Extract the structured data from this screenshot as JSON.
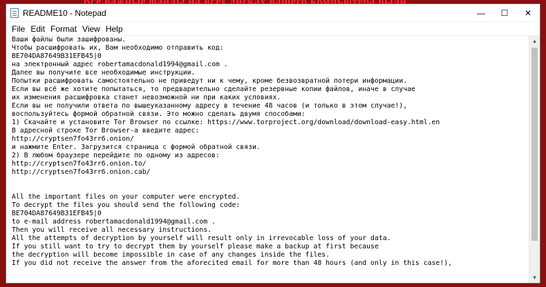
{
  "background": {
    "banner_text": "Все важные файлы на всех дисках вашего компьютера были"
  },
  "window": {
    "title": "README10 - Notepad",
    "controls": {
      "minimize": "—",
      "maximize": "☐",
      "close": "✕"
    }
  },
  "menu": [
    "File",
    "Edit",
    "Format",
    "View",
    "Help"
  ],
  "content": {
    "lines": [
      "Ваши файлы были зашифрованы.",
      "Чтобы расшифровать их, Вам необходимо отправить код:",
      "BE704DA87649B31EFB45|0",
      "на электронный адрес robertamacdonald1994@gmail.com .",
      "Далее вы получите все необходимые инструкции.",
      "Попытки расшифровать самостоятельно не приведут ни к чему, кроме безвозвратной потери информации.",
      "Если вы всё же хотите попытаться, то предварительно сделайте резервные копии файлов, иначе в случае",
      "их изменения расшифровка станет невозможной ни при каких условиях.",
      "Если вы не получили ответа по вышеуказанному адресу в течение 48 часов (и только в этом случае!),",
      "воспользуйтесь формой обратной связи. Это можно сделать двумя способами:",
      "1) Скачайте и установите Tor Browser по ссылке: https://www.torproject.org/download/download-easy.html.en",
      "В адресной строке Tor Browser-а введите адрес:",
      "http://cryptsen7fo43rr6.onion/",
      "и нажмите Enter. Загрузится страница с формой обратной связи.",
      "2) В любом браузере перейдите по одному из адресов:",
      "http://cryptsen7fo43rr6.onion.to/",
      "http://cryptsen7fo43rr6.onion.cab/",
      "",
      "",
      "All the important files on your computer were encrypted.",
      "To decrypt the files you should send the following code:",
      "BE704DA87649B31EFB45|0",
      "to e-mail address robertamacdonald1994@gmail.com .",
      "Then you will receive all necessary instructions.",
      "All the attempts of decryption by yourself will result only in irrevocable loss of your data.",
      "If you still want to try to decrypt them by yourself please make a backup at first because",
      "the decryption will become impossible in case of any changes inside the files.",
      "If you did not receive the answer from the aforecited email for more than 48 hours (and only in this case!),"
    ]
  },
  "scrollbar": {
    "up": "▲",
    "down": "▼"
  }
}
